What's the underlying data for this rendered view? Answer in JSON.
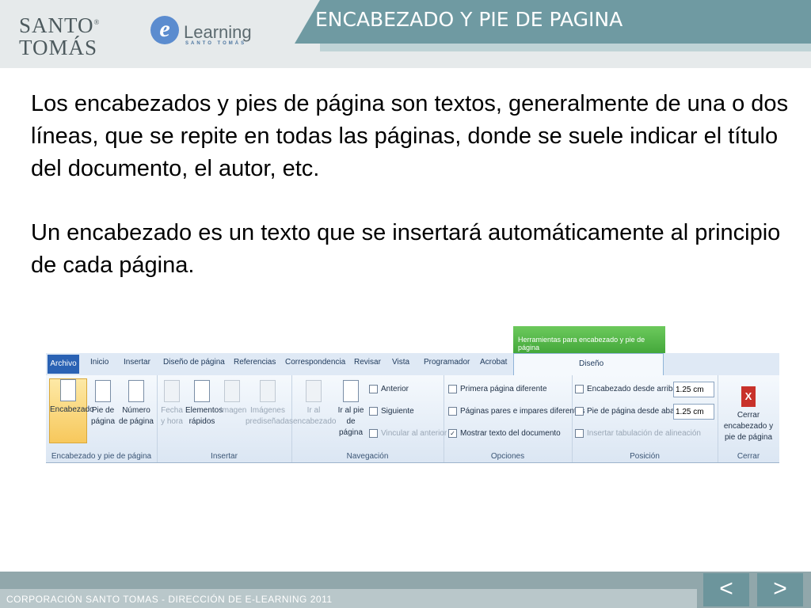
{
  "header": {
    "brand": "SANTO TOMÁS",
    "brand_line1": "SANTO",
    "brand_line2": "TOMÁS",
    "elearning": "Learning",
    "elearning_e": "e",
    "elearning_sub": "SANTO TOMÁS",
    "slide_title": "ENCABEZADO Y PIE DE PAGINA"
  },
  "body": {
    "paragraph1": "Los encabezados y pies de página son textos, generalmente de una o dos líneas, que se repite en todas las páginas, donde se suele indicar el título del documento, el autor, etc.",
    "paragraph2": "Un encabezado es un texto que se insertará automáticamente al principio de cada página."
  },
  "ribbon": {
    "context_tab": "Herramientas para encabezado y pie de página",
    "tabs": [
      "Archivo",
      "Inicio",
      "Insertar",
      "Diseño de página",
      "Referencias",
      "Correspondencia",
      "Revisar",
      "Vista",
      "Programador",
      "Acrobat"
    ],
    "active_tab": "Diseño",
    "groups": {
      "hf": {
        "label": "Encabezado y pie de página",
        "buttons": [
          "Encabezado",
          "Pie de página",
          "Número de página"
        ]
      },
      "insert": {
        "label": "Insertar",
        "buttons": [
          "Fecha y hora",
          "Elementos rápidos",
          "Imagen",
          "Imágenes prediseñadas"
        ]
      },
      "nav": {
        "label": "Navegación",
        "buttons": [
          "Ir al encabezado",
          "Ir al pie de página"
        ],
        "small": [
          "Anterior",
          "Siguiente",
          "Vincular al anterior"
        ]
      },
      "options": {
        "label": "Opciones",
        "checks": [
          "Primera página diferente",
          "Páginas pares e impares diferentes",
          "Mostrar texto del documento"
        ],
        "checked": [
          false,
          false,
          true
        ]
      },
      "position": {
        "label": "Posición",
        "header_from_top": "Encabezado desde arriba:",
        "footer_from_bottom": "Pie de página desde abajo:",
        "header_value": "1.25 cm",
        "footer_value": "1.25 cm",
        "insert_tab": "Insertar tabulación de alineación"
      },
      "close": {
        "label": "Cerrar",
        "button": "Cerrar encabezado y pie de página",
        "icon_label": "X"
      }
    }
  },
  "footer": {
    "text": "CORPORACIÓN SANTO TOMAS - DIRECCIÓN DE E-LEARNING  2011",
    "prev": "<",
    "next": ">"
  }
}
